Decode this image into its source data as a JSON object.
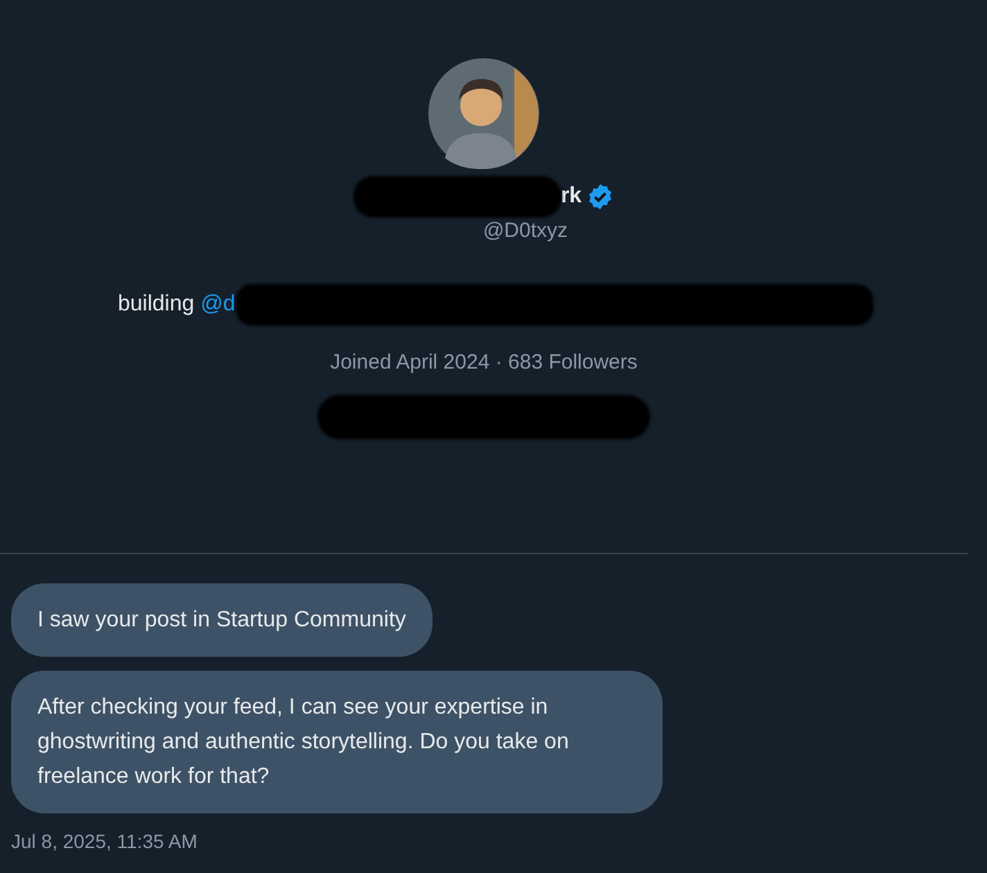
{
  "profile": {
    "name_visible": "rk",
    "verified": true,
    "handle": "@D0txyz",
    "bio": "building",
    "bio_link": "@d",
    "meta": "Joined April 2024 · 683 Followers"
  },
  "messages": [
    {
      "text": "I saw your post in Startup Community"
    },
    {
      "text": "After checking your feed, I can see your expertise in ghostwriting and authentic storytelling. Do you take on freelance work for that?"
    }
  ],
  "timestamp": "Jul 8, 2025, 11:35 AM"
}
